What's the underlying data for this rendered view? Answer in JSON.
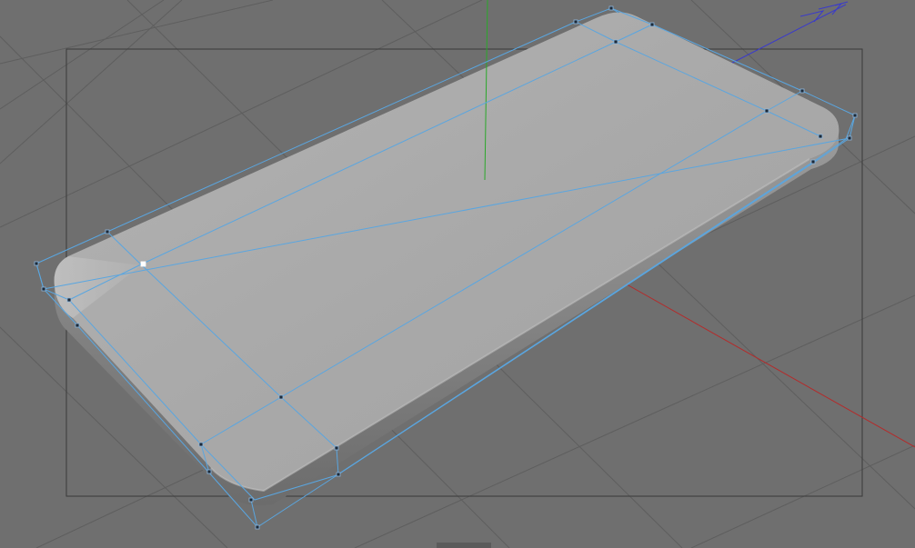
{
  "viewport": {
    "mode": "perspective",
    "background_color": "#6f6f6f",
    "grid_color": "#5e5e5e",
    "safe_frame_color": "#3a3a3a"
  },
  "axes": {
    "x_color": "#b52a2a",
    "y_color": "#2aa82a",
    "z_color": "#3a3acb"
  },
  "object": {
    "shape": "rounded-slab",
    "surface_color": "#a8a8a8",
    "cage_color": "#5aa6e0",
    "vertex_color": "#1c2a38",
    "selected_vertex_color": "#ffffff",
    "selected_vertex_count": 1,
    "icons": {
      "world_axis": "axis-gizmo-icon",
      "vertex": "point-handle-icon"
    }
  }
}
